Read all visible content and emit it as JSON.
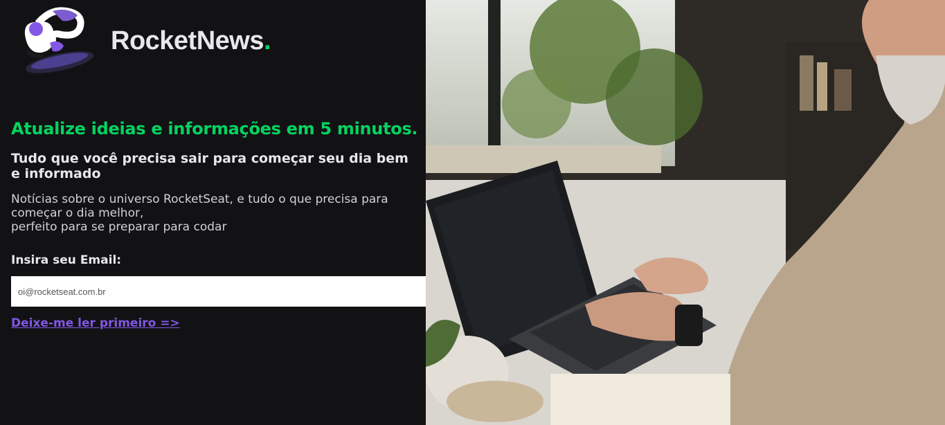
{
  "brand": {
    "name": "RocketNews",
    "dot": "."
  },
  "colors": {
    "background": "#121214",
    "accent_green": "#04d361",
    "accent_purple": "#8257e5",
    "text": "#e8e8ea"
  },
  "hero": {
    "headline": "Atualize ideias e informações em 5 minutos.",
    "subheadline": "Tudo que você precisa sair para começar seu dia bem e informado",
    "description_line1": "Notícias sobre o universo RocketSeat, e tudo o que precisa para começar o dia melhor,",
    "description_line2": "perfeito para se preparar para codar"
  },
  "form": {
    "email_label": "Insira seu Email:",
    "email_placeholder": "oi@rocketseat.com.br",
    "send_icon": "send-icon"
  },
  "link": {
    "read_first": "Deixe-me ler primeiro =>"
  },
  "photo": {
    "icon": "photo-man-laptop"
  }
}
